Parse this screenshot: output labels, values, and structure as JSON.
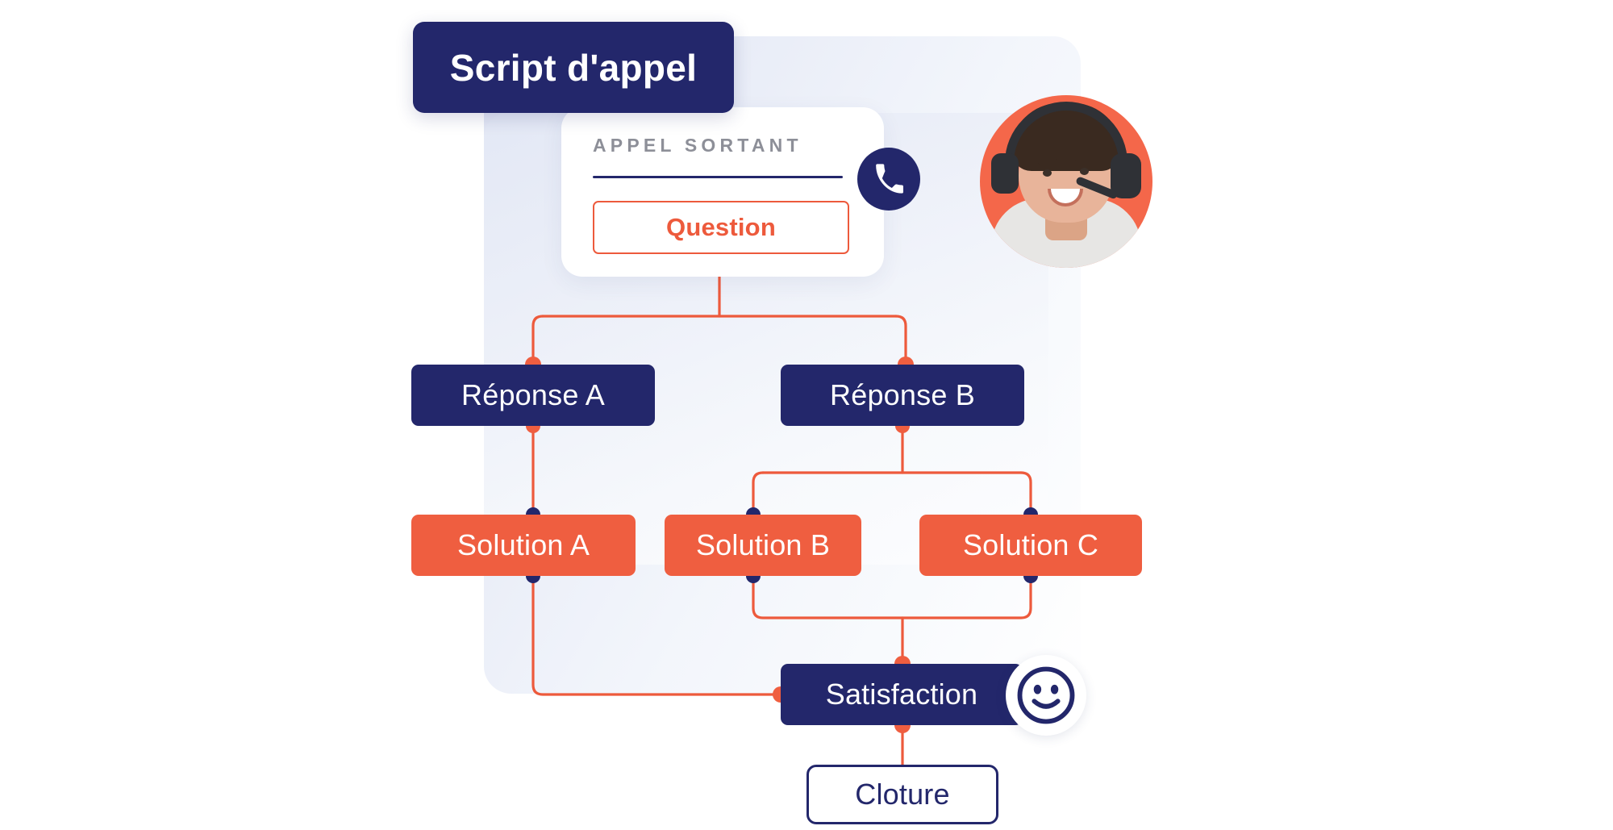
{
  "colors": {
    "navy": "#23276b",
    "orange": "#EF5E40",
    "connector": "#ED5A3C",
    "avatar_bg": "#F4674A",
    "label_gray": "#8d8f98",
    "page_bg": "#ffffff"
  },
  "title_badge": {
    "label": "Script d'appel"
  },
  "call_card": {
    "kicker": "APPEL SORTANT",
    "question_label": "Question",
    "phone_icon": "phone-icon",
    "divider": "card-divider"
  },
  "avatar": {
    "name": "agent-avatar",
    "description": "call center agent with headset"
  },
  "smiley": {
    "name": "smiley-face-icon"
  },
  "flow": {
    "type": "flowchart",
    "nodes": [
      {
        "id": "question",
        "label": "Question",
        "style": "outline-orange"
      },
      {
        "id": "reponse_a",
        "label": "Réponse A",
        "style": "navy"
      },
      {
        "id": "reponse_b",
        "label": "Réponse B",
        "style": "navy"
      },
      {
        "id": "solution_a",
        "label": "Solution A",
        "style": "orange"
      },
      {
        "id": "solution_b",
        "label": "Solution B",
        "style": "orange"
      },
      {
        "id": "solution_c",
        "label": "Solution C",
        "style": "orange"
      },
      {
        "id": "satisfaction",
        "label": "Satisfaction",
        "style": "navy"
      },
      {
        "id": "cloture",
        "label": "Cloture",
        "style": "outline-navy"
      }
    ],
    "edges": [
      {
        "from": "question",
        "to": "reponse_a"
      },
      {
        "from": "question",
        "to": "reponse_b"
      },
      {
        "from": "reponse_a",
        "to": "solution_a"
      },
      {
        "from": "reponse_b",
        "to": "solution_b"
      },
      {
        "from": "reponse_b",
        "to": "solution_c"
      },
      {
        "from": "solution_a",
        "to": "satisfaction"
      },
      {
        "from": "solution_b",
        "to": "satisfaction"
      },
      {
        "from": "solution_c",
        "to": "satisfaction"
      },
      {
        "from": "satisfaction",
        "to": "cloture"
      }
    ]
  }
}
